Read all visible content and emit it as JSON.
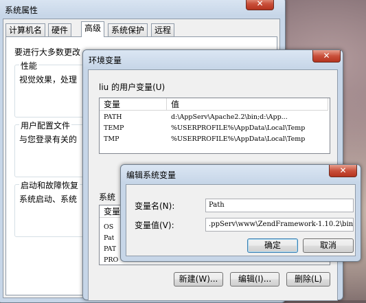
{
  "system_properties": {
    "title": "系统属性",
    "close": "✕",
    "tabs": [
      {
        "label": "计算机名"
      },
      {
        "label": "硬件"
      },
      {
        "label": "高级",
        "selected": true
      },
      {
        "label": "系统保护"
      },
      {
        "label": "远程"
      }
    ],
    "intro": "要进行大多数更改",
    "performance": {
      "heading": "性能",
      "text": "视觉效果，处理"
    },
    "user_profiles": {
      "heading": "用户配置文件",
      "text": "与您登录有关的"
    },
    "startup_recovery": {
      "heading": "启动和故障恢复",
      "text": "系统启动、系统"
    }
  },
  "env_vars": {
    "title": "环境变量",
    "close": "✕",
    "user_vars_label": "liu 的用户变量(U)",
    "columns": {
      "name": "变量",
      "value": "值"
    },
    "user_vars": [
      {
        "name": "PATH",
        "value": "d:\\AppServ\\Apache2.2\\bin;d:\\App..."
      },
      {
        "name": "TEMP",
        "value": "%USERPROFILE%\\AppData\\Local\\Temp"
      },
      {
        "name": "TMP",
        "value": "%USERPROFILE%\\AppData\\Local\\Temp"
      }
    ],
    "system_vars_label": "系统",
    "system_header_partial": "变量",
    "system_vars_partial": [
      "OS",
      "Pat",
      "PAT",
      "PRO"
    ],
    "buttons": {
      "new": "新建(W)...",
      "edit": "编辑(I)...",
      "delete": "删除(L)"
    }
  },
  "edit_dialog": {
    "title": "编辑系统变量",
    "close": "✕",
    "name_label": "变量名(N):",
    "name_value": "Path",
    "value_label": "变量值(V):",
    "value_value": ".ppServ\\www\\ZendFramework-1.10.2\\bin",
    "ok": "确定",
    "cancel": "取消"
  }
}
